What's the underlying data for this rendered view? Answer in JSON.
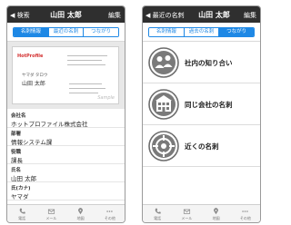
{
  "left": {
    "nav": {
      "back": "◀ 検索",
      "title": "山田 太郎",
      "edit": "編集"
    },
    "segments": [
      "名刺情報",
      "最近の名刺",
      "つながり"
    ],
    "card": {
      "logo": "HotProfile",
      "name_small": "ヤマダ タロウ",
      "name": "山田 太郎",
      "sample": "Sample"
    },
    "fields": [
      {
        "label": "会社名",
        "value": "ホットプロファイル株式会社"
      },
      {
        "label": "部署",
        "value": "情報システム課"
      },
      {
        "label": "役職",
        "value": "課長"
      },
      {
        "label": "氏名",
        "value": "山田 太郎"
      },
      {
        "label": "氏(カナ)",
        "value": "ヤマダ"
      }
    ]
  },
  "right": {
    "nav": {
      "back": "◀ 最近の名刺",
      "title": "山田 太郎",
      "edit": "編集"
    },
    "segments": [
      "名刺情報",
      "過去の名刺",
      "つながり"
    ],
    "menu": [
      "社内の知り合い",
      "同じ会社の名刺",
      "近くの名刺"
    ]
  },
  "tabbar": [
    "電話",
    "メール",
    "地図",
    "その他"
  ],
  "colors": {
    "accent": "#1e88e5",
    "navbar": "#2f2f2f",
    "logo": "#d32f2f"
  }
}
